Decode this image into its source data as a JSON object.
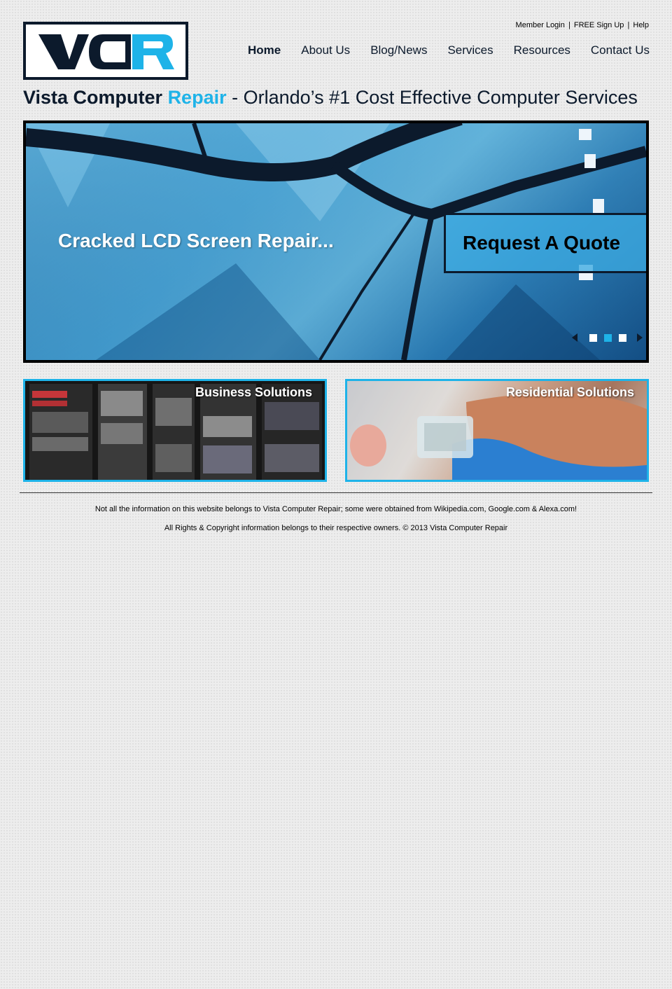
{
  "brand": {
    "logo_text": "VCR",
    "colors": {
      "navy": "#0c1a2c",
      "accent": "#1eb3e8"
    }
  },
  "utility": {
    "member_login": "Member Login",
    "signup": "FREE Sign Up",
    "help": "Help",
    "separator": "|"
  },
  "nav": {
    "items": [
      {
        "label": "Home"
      },
      {
        "label": "About Us"
      },
      {
        "label": "Blog/News"
      },
      {
        "label": "Services"
      },
      {
        "label": "Resources"
      },
      {
        "label": "Contact Us"
      }
    ]
  },
  "headline": {
    "part1": "Vista Computer",
    "part2": "Repair",
    "part3": "- Orlando’s #1 Cost Effective Computer Services"
  },
  "slider": {
    "caption": "Cracked LCD Screen Repair...",
    "cta": "Request A Quote",
    "active_index": 1,
    "dot_count": 3
  },
  "panels": {
    "business": {
      "title": "Business Solutions"
    },
    "residential": {
      "title": "Residential Solutions"
    }
  },
  "footer": {
    "line1": "Not all the information on this website belongs to Vista Computer Repair; some were obtained from Wikipedia.com, Google.com & Alexa.com!",
    "line2": "All Rights & Copyright information belongs to their respective owners. © 2013 Vista Computer Repair"
  }
}
